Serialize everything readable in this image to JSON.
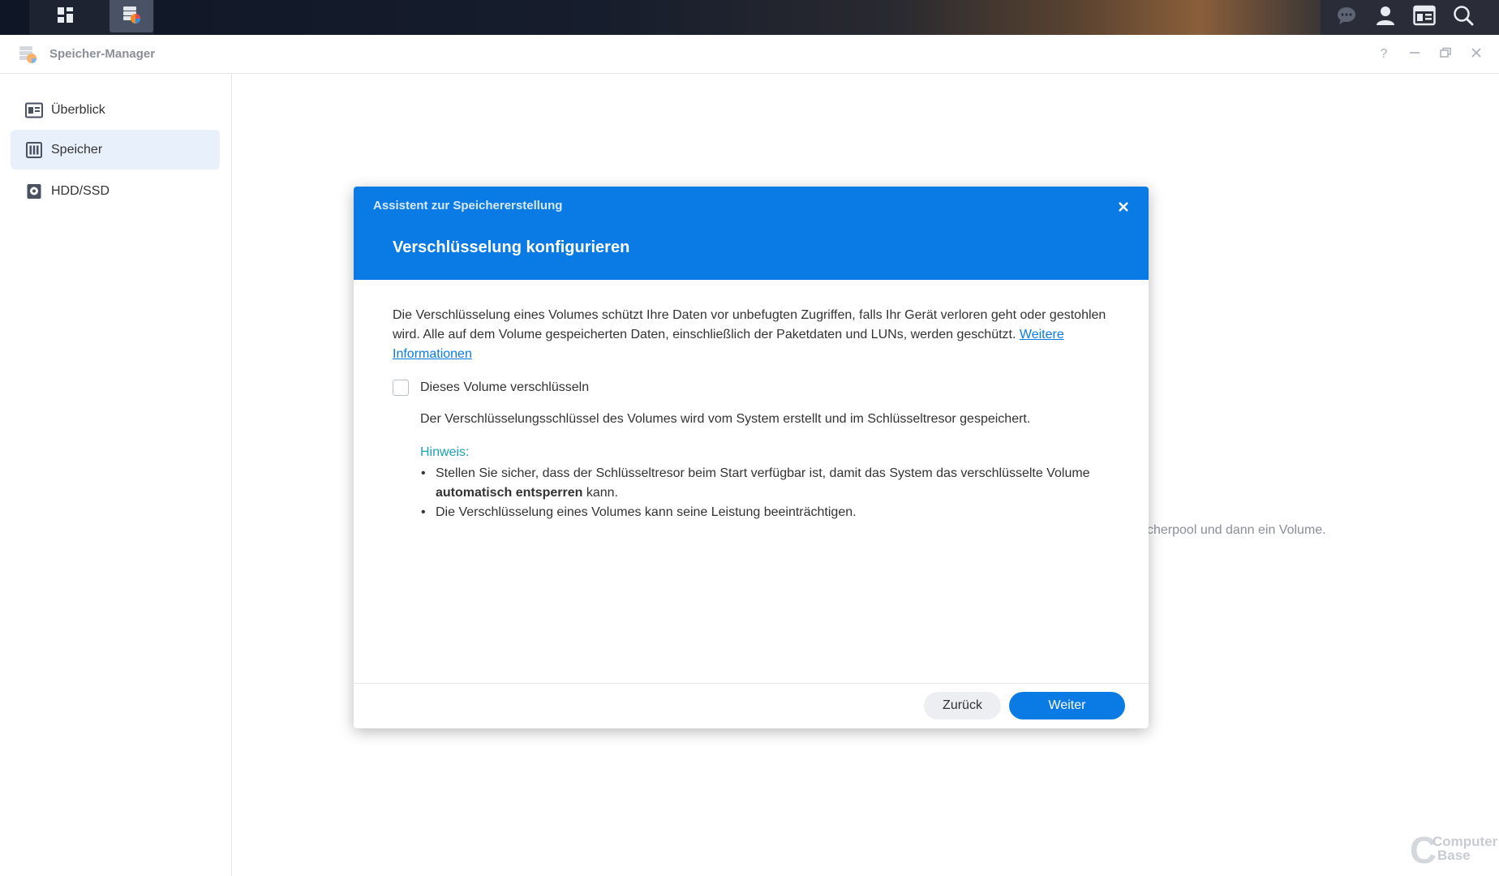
{
  "window": {
    "title": "Speicher-Manager"
  },
  "taskbar": {
    "left_icons": [
      "main-menu-icon",
      "storage-manager-app-icon"
    ],
    "right_icons": [
      "chat-icon",
      "user-icon",
      "widgets-icon",
      "search-icon"
    ]
  },
  "sidebar": {
    "items": [
      {
        "label": "Überblick",
        "icon": "overview-icon",
        "active": false
      },
      {
        "label": "Speicher",
        "icon": "storage-icon",
        "active": true
      },
      {
        "label": "HDD/SSD",
        "icon": "drive-icon",
        "active": false
      }
    ]
  },
  "main": {
    "background_hint": "cherpool und dann ein Volume."
  },
  "watermark": {
    "line1": "Computer",
    "line2": "Base"
  },
  "dialog": {
    "wizard_title": "Assistent zur Speichererstellung",
    "title": "Verschlüsselung konfigurieren",
    "description": "Die Verschlüsselung eines Volumes schützt Ihre Daten vor unbefugten Zugriffen, falls Ihr Gerät verloren geht oder gestohlen wird. Alle auf dem Volume gespeicherten Daten, einschließlich der Paketdaten und LUNs, werden geschützt.",
    "more_info_link": "Weitere Informationen",
    "checkbox_label": "Dieses Volume verschlüsseln",
    "checkbox_checked": false,
    "subtext": "Der Verschlüsselungsschlüssel des Volumes wird vom System erstellt und im Schlüsseltresor gespeichert.",
    "hint_title": "Hinweis:",
    "hint1_before": "Stellen Sie sicher, dass der Schlüsseltresor beim Start verfügbar ist, damit das System das verschlüsselte Volume",
    "hint1_bold": "automatisch entsperren",
    "hint1_after": "kann.",
    "hint2": "Die Verschlüsselung eines Volumes kann seine Leistung beeinträchtigen.",
    "back_label": "Zurück",
    "next_label": "Weiter"
  },
  "colors": {
    "accent": "#0a7be4",
    "hint": "#1aa3b8",
    "sidebar_active": "#e8f1fb"
  }
}
